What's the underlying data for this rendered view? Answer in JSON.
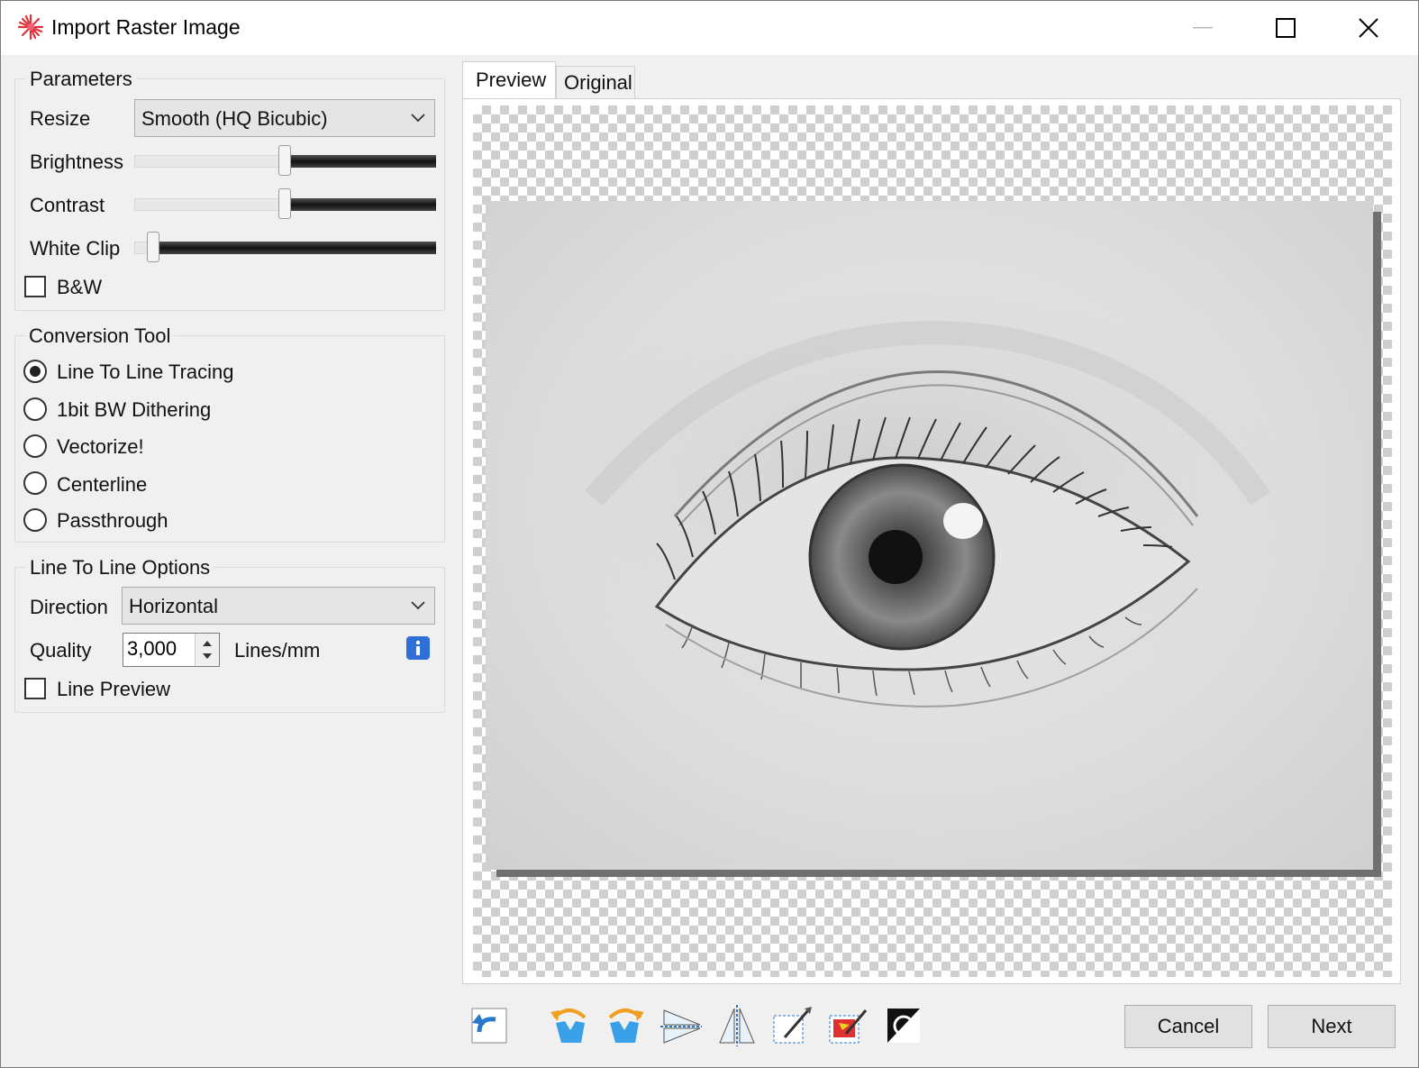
{
  "window": {
    "title": "Import Raster Image"
  },
  "parameters": {
    "group_label": "Parameters",
    "resize_label": "Resize",
    "resize_value": "Smooth (HQ Bicubic)",
    "brightness_label": "Brightness",
    "brightness_level": 0.5,
    "contrast_label": "Contrast",
    "contrast_level": 0.5,
    "white_clip_label": "White Clip",
    "white_clip_level": 0.05,
    "bw_label": "B&W",
    "bw_checked": false
  },
  "conversion": {
    "group_label": "Conversion Tool",
    "options": [
      {
        "label": "Line To Line Tracing",
        "selected": true
      },
      {
        "label": "1bit BW Dithering",
        "selected": false
      },
      {
        "label": "Vectorize!",
        "selected": false
      },
      {
        "label": "Centerline",
        "selected": false
      },
      {
        "label": "Passthrough",
        "selected": false
      }
    ]
  },
  "line_options": {
    "group_label": "Line To Line Options",
    "direction_label": "Direction",
    "direction_value": "Horizontal",
    "quality_label": "Quality",
    "quality_value": "3,000",
    "quality_unit": "Lines/mm",
    "line_preview_label": "Line Preview",
    "line_preview_checked": false
  },
  "tabs": [
    {
      "label": "Preview",
      "active": true
    },
    {
      "label": "Original",
      "active": false
    }
  ],
  "toolbar": {
    "icons": [
      "undo-icon",
      "rotate-left-icon",
      "rotate-right-icon",
      "flip-horizontal-icon",
      "flip-vertical-icon",
      "crop-icon",
      "mask-icon",
      "invert-icon"
    ]
  },
  "buttons": {
    "cancel": "Cancel",
    "next": "Next"
  },
  "colors": {
    "info_blue": "#2e6fd8",
    "app_icon_red": "#e0303a"
  }
}
